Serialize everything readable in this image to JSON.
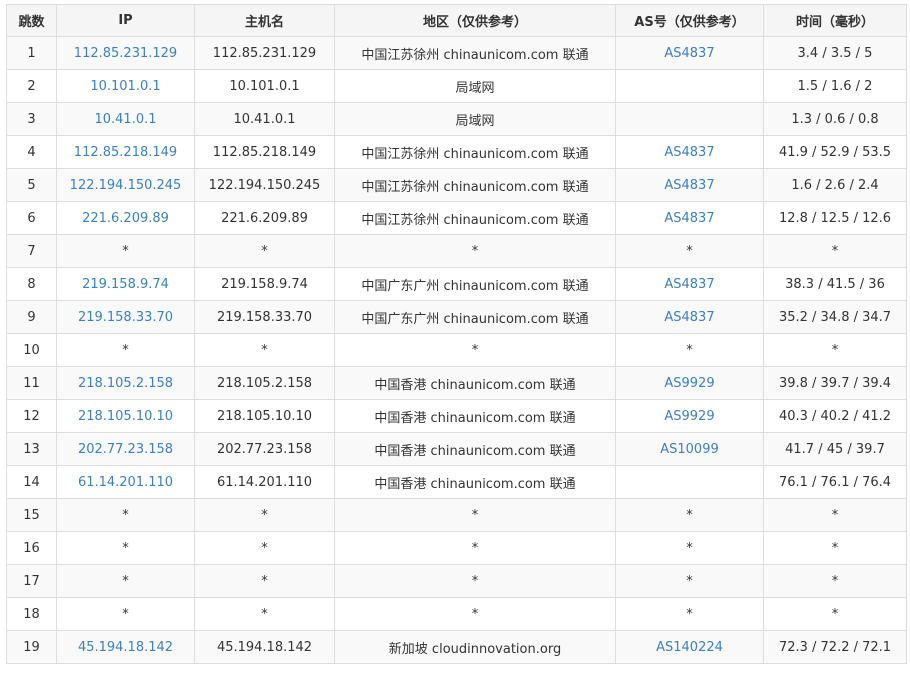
{
  "headers": [
    "跳数",
    "IP",
    "主机名",
    "地区（仅供参考）",
    "AS号（仅供参考）",
    "时间（毫秒）"
  ],
  "rows": [
    [
      "1",
      "112.85.231.129",
      "112.85.231.129",
      "中国江苏徐州 chinaunicom.com 联通",
      "AS4837",
      "3.4 / 3.5 / 5"
    ],
    [
      "2",
      "10.101.0.1",
      "10.101.0.1",
      "局域网",
      "",
      "1.5 / 1.6 / 2"
    ],
    [
      "3",
      "10.41.0.1",
      "10.41.0.1",
      "局域网",
      "",
      "1.3 / 0.6 / 0.8"
    ],
    [
      "4",
      "112.85.218.149",
      "112.85.218.149",
      "中国江苏徐州 chinaunicom.com 联通",
      "AS4837",
      "41.9 / 52.9 / 53.5"
    ],
    [
      "5",
      "122.194.150.245",
      "122.194.150.245",
      "中国江苏徐州 chinaunicom.com 联通",
      "AS4837",
      "1.6 / 2.6 / 2.4"
    ],
    [
      "6",
      "221.6.209.89",
      "221.6.209.89",
      "中国江苏徐州 chinaunicom.com 联通",
      "AS4837",
      "12.8 / 12.5 / 12.6"
    ],
    [
      "7",
      "*",
      "*",
      "*",
      "*",
      "*"
    ],
    [
      "8",
      "219.158.9.74",
      "219.158.9.74",
      "中国广东广州 chinaunicom.com 联通",
      "AS4837",
      "38.3 / 41.5 / 36"
    ],
    [
      "9",
      "219.158.33.70",
      "219.158.33.70",
      "中国广东广州 chinaunicom.com 联通",
      "AS4837",
      "35.2 / 34.8 / 34.7"
    ],
    [
      "10",
      "*",
      "*",
      "*",
      "*",
      "*"
    ],
    [
      "11",
      "218.105.2.158",
      "218.105.2.158",
      "中国香港 chinaunicom.com 联通",
      "AS9929",
      "39.8 / 39.7 / 39.4"
    ],
    [
      "12",
      "218.105.10.10",
      "218.105.10.10",
      "中国香港 chinaunicom.com 联通",
      "AS9929",
      "40.3 / 40.2 / 41.2"
    ],
    [
      "13",
      "202.77.23.158",
      "202.77.23.158",
      "中国香港 chinaunicom.com 联通",
      "AS10099",
      "41.7 / 45 / 39.7"
    ],
    [
      "14",
      "61.14.201.110",
      "61.14.201.110",
      "中国香港 chinaunicom.com 联通",
      "",
      "76.1 / 76.1 / 76.4"
    ],
    [
      "15",
      "*",
      "*",
      "*",
      "*",
      "*"
    ],
    [
      "16",
      "*",
      "*",
      "*",
      "*",
      "*"
    ],
    [
      "17",
      "*",
      "*",
      "*",
      "*",
      "*"
    ],
    [
      "18",
      "*",
      "*",
      "*",
      "*",
      "*"
    ],
    [
      "19",
      "45.194.18.142",
      "45.194.18.142",
      "新加坡 cloudinnovation.org",
      "AS140224",
      "72.3 / 72.2 / 72.1"
    ]
  ],
  "colors": {
    "link": "#3b7fc4",
    "border": "#dddddd",
    "header_bg": "#f5f5f5"
  }
}
